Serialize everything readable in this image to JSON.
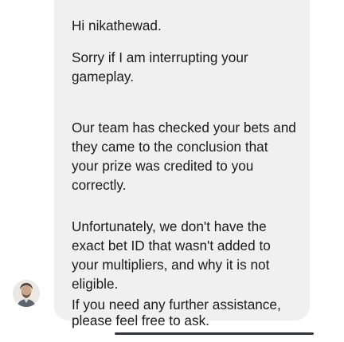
{
  "message": {
    "paragraphs": [
      "Hi nikathewad.",
      "Sorry if I am interrupting your gameplay.",
      "Our team has checked your bets and they came to the conclusion that your prize was credited to you correctly.",
      "Unfortunately, we don't have the exact bet ID that wasn't added to your multipliers, and why it is not eligible.",
      "If you need any further assistance,",
      "please feel free to ask."
    ]
  },
  "sender": {
    "avatar_icon": "agent-avatar-icon"
  }
}
